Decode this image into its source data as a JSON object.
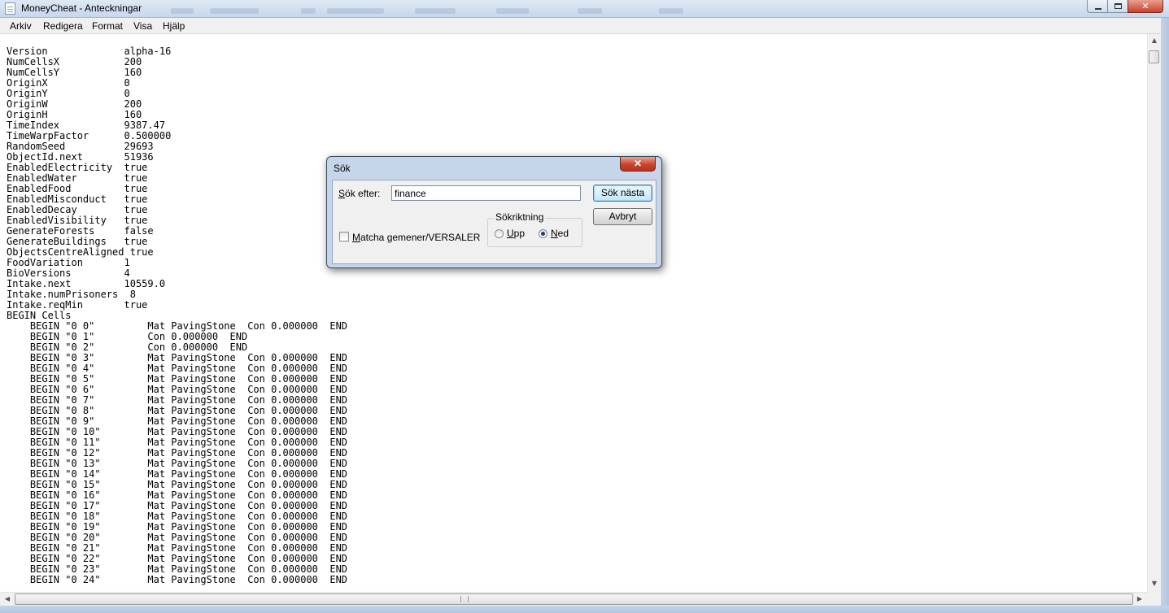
{
  "window": {
    "title": "MoneyCheat - Anteckningar",
    "close_glyph": "✕"
  },
  "menu": [
    "Arkiv",
    "Redigera",
    "Format",
    "Visa",
    "Hjälp"
  ],
  "document": {
    "lines": [
      "Version             alpha-16",
      "NumCellsX           200",
      "NumCellsY           160",
      "OriginX             0",
      "OriginY             0",
      "OriginW             200",
      "OriginH             160",
      "TimeIndex           9387.47",
      "TimeWarpFactor      0.500000",
      "RandomSeed          29693",
      "ObjectId.next       51936",
      "EnabledElectricity  true",
      "EnabledWater        true",
      "EnabledFood         true",
      "EnabledMisconduct   true",
      "EnabledDecay        true",
      "EnabledVisibility   true",
      "GenerateForests     false",
      "GenerateBuildings   true",
      "ObjectsCentreAligned true",
      "FoodVariation       1",
      "BioVersions         4",
      "Intake.next         10559.0",
      "Intake.numPrisoners  8",
      "Intake.reqMin       true",
      "BEGIN Cells",
      "    BEGIN \"0 0\"         Mat PavingStone  Con 0.000000  END",
      "    BEGIN \"0 1\"         Con 0.000000  END",
      "    BEGIN \"0 2\"         Con 0.000000  END",
      "    BEGIN \"0 3\"         Mat PavingStone  Con 0.000000  END",
      "    BEGIN \"0 4\"         Mat PavingStone  Con 0.000000  END",
      "    BEGIN \"0 5\"         Mat PavingStone  Con 0.000000  END",
      "    BEGIN \"0 6\"         Mat PavingStone  Con 0.000000  END",
      "    BEGIN \"0 7\"         Mat PavingStone  Con 0.000000  END",
      "    BEGIN \"0 8\"         Mat PavingStone  Con 0.000000  END",
      "    BEGIN \"0 9\"         Mat PavingStone  Con 0.000000  END",
      "    BEGIN \"0 10\"        Mat PavingStone  Con 0.000000  END",
      "    BEGIN \"0 11\"        Mat PavingStone  Con 0.000000  END",
      "    BEGIN \"0 12\"        Mat PavingStone  Con 0.000000  END",
      "    BEGIN \"0 13\"        Mat PavingStone  Con 0.000000  END",
      "    BEGIN \"0 14\"        Mat PavingStone  Con 0.000000  END",
      "    BEGIN \"0 15\"        Mat PavingStone  Con 0.000000  END",
      "    BEGIN \"0 16\"        Mat PavingStone  Con 0.000000  END",
      "    BEGIN \"0 17\"        Mat PavingStone  Con 0.000000  END",
      "    BEGIN \"0 18\"        Mat PavingStone  Con 0.000000  END",
      "    BEGIN \"0 19\"        Mat PavingStone  Con 0.000000  END",
      "    BEGIN \"0 20\"        Mat PavingStone  Con 0.000000  END",
      "    BEGIN \"0 21\"        Mat PavingStone  Con 0.000000  END",
      "    BEGIN \"0 22\"        Mat PavingStone  Con 0.000000  END",
      "    BEGIN \"0 23\"        Mat PavingStone  Con 0.000000  END",
      "    BEGIN \"0 24\"        Mat PavingStone  Con 0.000000  END"
    ]
  },
  "find_dialog": {
    "title": "Sök",
    "close_glyph": "✕",
    "find_label_key": "S",
    "find_label_rest": "ök efter:",
    "find_value": "finance",
    "find_next_button": "Sök nästa",
    "cancel_button": "Avbryt",
    "direction_label": "Sökriktning",
    "up_key": "U",
    "up_rest": "pp",
    "down_key": "N",
    "down_rest": "ed",
    "down_selected": true,
    "match_case_key": "M",
    "match_case_rest": "atcha gemener/VERSALER",
    "match_case_checked": false
  },
  "scroll": {
    "up_glyph": "▲",
    "down_glyph": "▼",
    "left_glyph": "◀",
    "right_glyph": "▶"
  },
  "icons": {
    "app": "notepad-icon",
    "minimize": "minimize-icon",
    "maximize": "maximize-icon",
    "close": "close-icon"
  }
}
